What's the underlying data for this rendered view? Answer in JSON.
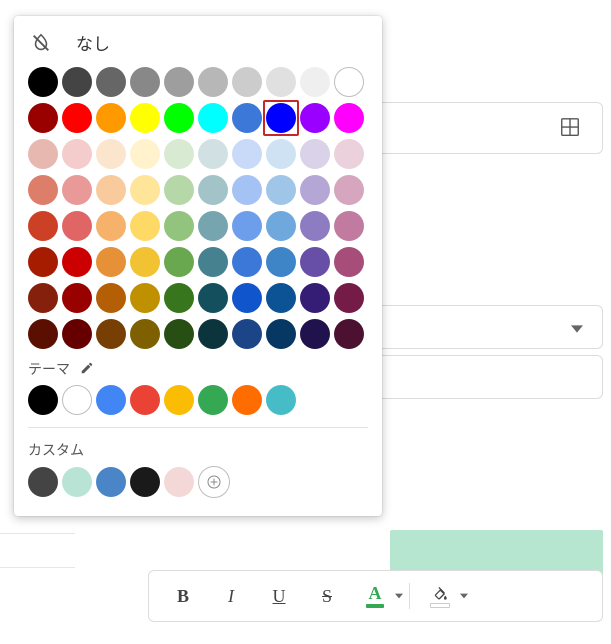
{
  "picker": {
    "none_label": "なし",
    "theme_label": "テーマ",
    "custom_label": "カスタム",
    "selected_index": 17,
    "grayscale": [
      "#000000",
      "#444444",
      "#666666",
      "#888888",
      "#9e9e9e",
      "#b7b7b7",
      "#cccccc",
      "#e0e0e0",
      "#efefef",
      {
        "hollow": true
      }
    ],
    "standard": [
      "#990000",
      "#ff0000",
      "#ff9900",
      "#ffff00",
      "#00ff00",
      "#00ffff",
      "#3c78d8",
      "#0000ff",
      "#9900ff",
      "#ff00ff"
    ],
    "tints": [
      [
        "#e6b8af",
        "#f4cccc",
        "#fce5cd",
        "#fff2cc",
        "#d9ead3",
        "#d0e0e3",
        "#c9daf8",
        "#cfe2f3",
        "#d9d2e9",
        "#ead1dc"
      ],
      [
        "#dd7e6b",
        "#ea9999",
        "#f9cb9c",
        "#ffe599",
        "#b6d7a8",
        "#a2c4c9",
        "#a4c2f4",
        "#9fc5e8",
        "#b4a7d6",
        "#d5a6bd"
      ],
      [
        "#cc4125",
        "#e06666",
        "#f6b26b",
        "#ffd966",
        "#93c47d",
        "#76a5af",
        "#6d9eeb",
        "#6fa8dc",
        "#8e7cc3",
        "#c27ba0"
      ],
      [
        "#a61c00",
        "#cc0000",
        "#e69138",
        "#f1c232",
        "#6aa84f",
        "#45818e",
        "#3c78d8",
        "#3d85c6",
        "#674ea7",
        "#a64d79"
      ],
      [
        "#85200c",
        "#990000",
        "#b45f06",
        "#bf9000",
        "#38761d",
        "#134f5c",
        "#1155cc",
        "#0b5394",
        "#351c75",
        "#741b47"
      ],
      [
        "#5b0f00",
        "#660000",
        "#783f04",
        "#7f6000",
        "#274e13",
        "#0c343d",
        "#1c4587",
        "#073763",
        "#20124d",
        "#4c1130"
      ]
    ],
    "theme": [
      "#000000",
      {
        "hollow": true
      },
      "#4285f4",
      "#ea4335",
      "#fbbc04",
      "#34a853",
      "#ff6d01",
      "#46bdc6"
    ],
    "custom": [
      "#444444",
      "#b9e4d5",
      "#4a86c7",
      "#1a1a1a",
      "#f4d7d7"
    ]
  },
  "toolbar": {
    "bold": "B",
    "italic": "I",
    "underline": "U",
    "strike": "S",
    "textcolor_letter": "A",
    "textcolor_bar": "#34a853",
    "fillcolor_bar": "#ffffff"
  }
}
